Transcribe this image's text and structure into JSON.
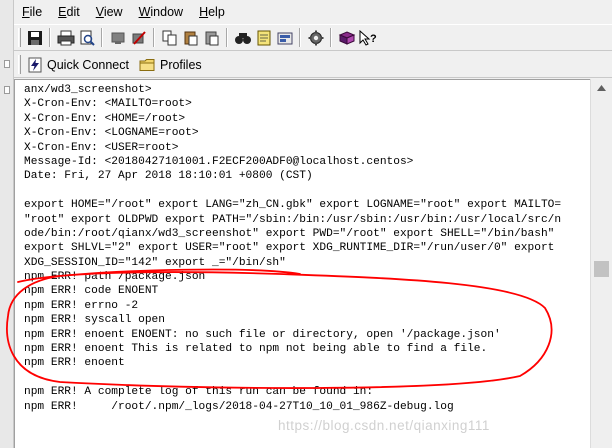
{
  "menu": [
    {
      "underline": "F",
      "rest": "ile"
    },
    {
      "underline": "E",
      "rest": "dit"
    },
    {
      "underline": "V",
      "rest": "iew"
    },
    {
      "underline": "W",
      "rest": "indow"
    },
    {
      "underline": "H",
      "rest": "elp"
    }
  ],
  "quick_connect": "Quick Connect",
  "profiles": "Profiles",
  "terminal_lines": [
    "anx/wd3_screenshot>",
    "X-Cron-Env: <MAILTO=root>",
    "X-Cron-Env: <HOME=/root>",
    "X-Cron-Env: <LOGNAME=root>",
    "X-Cron-Env: <USER=root>",
    "Message-Id: <20180427101001.F2ECF200ADF0@localhost.centos>",
    "Date: Fri, 27 Apr 2018 18:10:01 +0800 (CST)",
    "",
    "export HOME=\"/root\" export LANG=\"zh_CN.gbk\" export LOGNAME=\"root\" export MAILTO=",
    "\"root\" export OLDPWD export PATH=\"/sbin:/bin:/usr/sbin:/usr/bin:/usr/local/src/n",
    "ode/bin:/root/qianx/wd3_screenshot\" export PWD=\"/root\" export SHELL=\"/bin/bash\"",
    "export SHLVL=\"2\" export USER=\"root\" export XDG_RUNTIME_DIR=\"/run/user/0\" export",
    "XDG_SESSION_ID=\"142\" export _=\"/bin/sh\"",
    "npm ERR! path /package.json",
    "npm ERR! code ENOENT",
    "npm ERR! errno -2",
    "npm ERR! syscall open",
    "npm ERR! enoent ENOENT: no such file or directory, open '/package.json'",
    "npm ERR! enoent This is related to npm not being able to find a file.",
    "npm ERR! enoent",
    "",
    "npm ERR! A complete log of this run can be found in:",
    "npm ERR!     /root/.npm/_logs/2018-04-27T10_10_01_986Z-debug.log"
  ],
  "watermark": "https://blog.csdn.net/qianxing111",
  "colors": {
    "annotation": "#ff0000"
  },
  "icons": {
    "toolbar": [
      "save-icon",
      "print-icon",
      "print-preview-icon",
      "connect-icon",
      "disconnect-icon",
      "copy-icon",
      "paste-icon",
      "paste-special-icon",
      "find-icon",
      "notes-icon",
      "settings-icon",
      "options-icon",
      "book-icon",
      "help-icon"
    ],
    "quickbar": [
      "lightning-icon",
      "folder-icon"
    ]
  }
}
